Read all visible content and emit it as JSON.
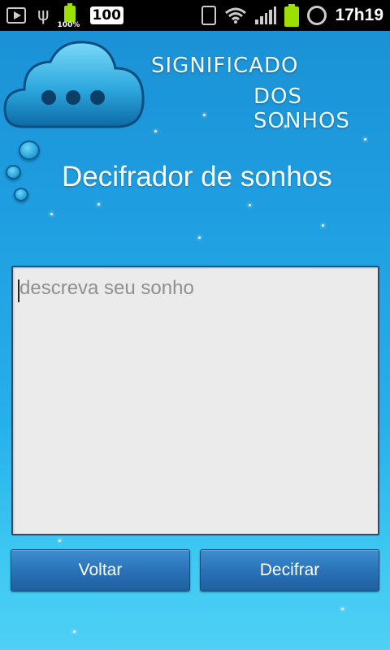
{
  "status_bar": {
    "battery_small_percent": "100%",
    "badge": "100",
    "time": "17h19",
    "icons": [
      "play-store-icon",
      "usb-icon",
      "battery-charging-icon",
      "vibrate-icon",
      "wifi-icon",
      "signal-icon",
      "battery-icon",
      "alarm-icon"
    ]
  },
  "logo": {
    "line1": "SIGNIFICADO",
    "line2": "DOS SONHOS",
    "icon": "cloud-chat-icon"
  },
  "screen": {
    "title": "Decifrador de sonhos"
  },
  "input": {
    "placeholder": "descreva seu sonho",
    "value": ""
  },
  "buttons": {
    "back_label": "Voltar",
    "decode_label": "Decifrar"
  },
  "colors": {
    "background_top": "#1a8fd4",
    "background_bottom": "#4fd0f5",
    "button": "#2a72b8",
    "input_bg": "#ebebeb"
  }
}
